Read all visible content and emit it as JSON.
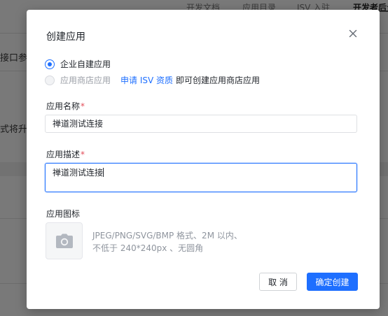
{
  "background": {
    "nav": [
      "开发文档",
      "应用目录",
      "ISV 入驻",
      "开发者后台"
    ],
    "fragments": [
      "接口参数",
      "式将升级"
    ]
  },
  "modal": {
    "title": "创建应用",
    "close_icon": "close-icon",
    "app_type": {
      "options": [
        {
          "label": "企业自建应用",
          "checked": true,
          "disabled": false
        },
        {
          "label": "应用商店应用",
          "checked": false,
          "disabled": true
        }
      ],
      "isv_link": "申请 ISV 资质",
      "isv_suffix": "即可创建应用商店应用"
    },
    "name": {
      "label": "应用名称",
      "required_mark": "*",
      "value": "禅道测试连接"
    },
    "description": {
      "label": "应用描述",
      "required_mark": "*",
      "value": "禅道测试连接"
    },
    "icon": {
      "label": "应用图标",
      "upload_icon": "camera-icon",
      "hint_line1": "JPEG/PNG/SVG/BMP 格式、2M 以内、",
      "hint_line2": "不低于 240*240px 、无圆角"
    },
    "buttons": {
      "cancel": "取 消",
      "confirm": "确定创建"
    }
  },
  "colors": {
    "primary": "#1e6fff",
    "required": "#e34d59",
    "overlay": "#797979"
  }
}
